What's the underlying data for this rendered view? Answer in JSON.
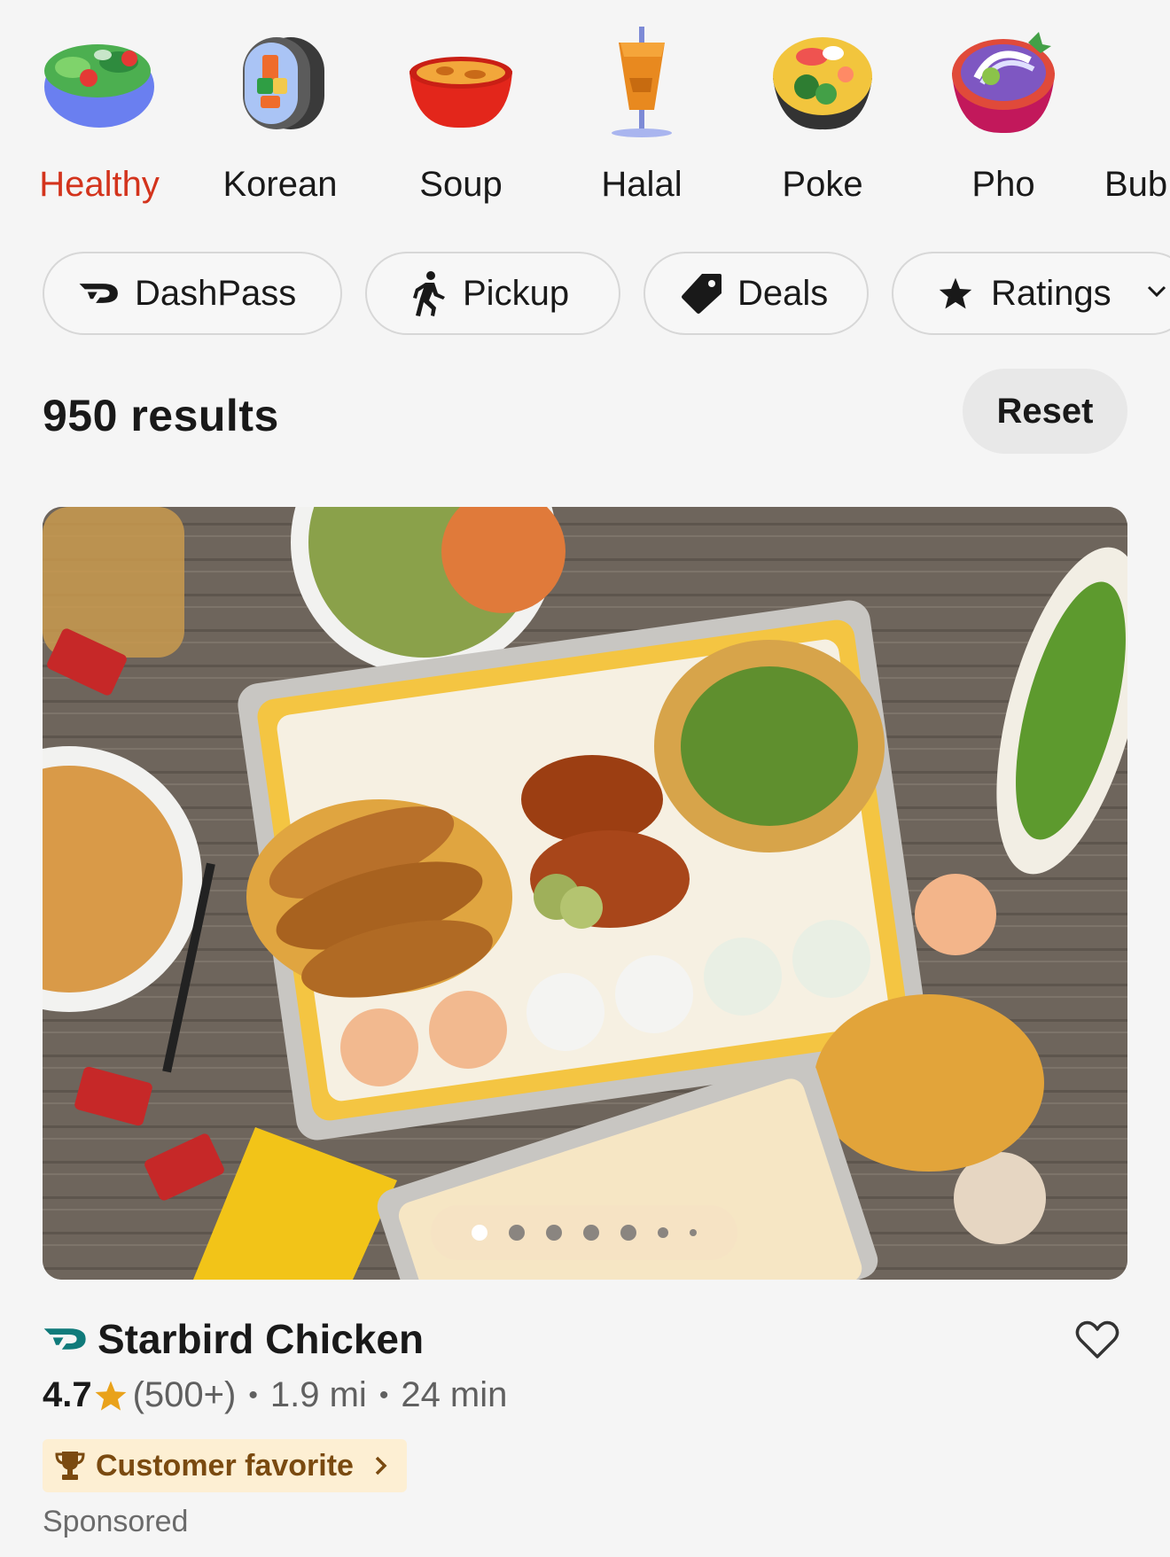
{
  "categories": [
    {
      "label": "Healthy",
      "icon": "salad-bowl-icon",
      "active": true
    },
    {
      "label": "Korean",
      "icon": "kimbap-icon",
      "active": false
    },
    {
      "label": "Soup",
      "icon": "soup-bowl-icon",
      "active": false
    },
    {
      "label": "Halal",
      "icon": "shawarma-icon",
      "active": false
    },
    {
      "label": "Poke",
      "icon": "poke-bowl-icon",
      "active": false
    },
    {
      "label": "Pho",
      "icon": "pho-bowl-icon",
      "active": false
    },
    {
      "label": "Bub",
      "icon": "bubble-tea-icon",
      "active": false
    }
  ],
  "filters": {
    "dashpass": "DashPass",
    "pickup": "Pickup",
    "deals": "Deals",
    "ratings": "Ratings"
  },
  "results": {
    "count_label": "950 results",
    "reset_label": "Reset"
  },
  "store": {
    "name": "Starbird Chicken",
    "rating": "4.7",
    "reviews": "(500+)",
    "separator": "•",
    "distance": "1.9 mi",
    "eta": "24 min",
    "badge": "Customer favorite",
    "sponsored": "Sponsored",
    "image_index": 1,
    "image_count": 7
  },
  "colors": {
    "accent": "#d3331c",
    "star": "#e9a21b",
    "badge_bg": "#fdefd3",
    "badge_text": "#7a4a10",
    "dashpass_teal": "#0f7a7a"
  }
}
